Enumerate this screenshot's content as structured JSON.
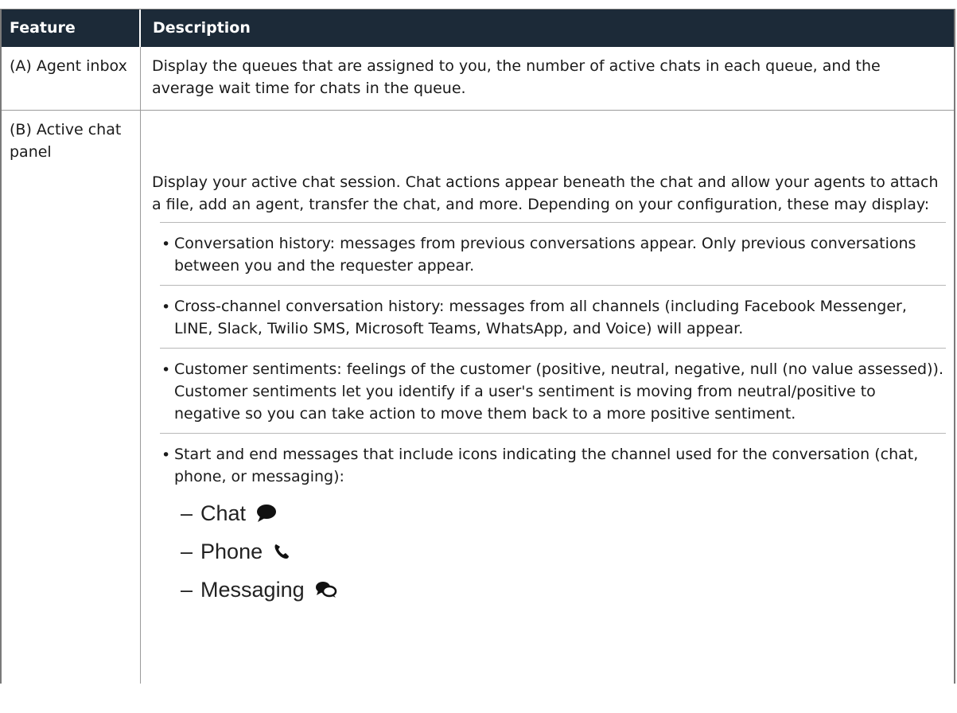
{
  "table": {
    "headers": [
      "Feature",
      "Description"
    ],
    "rows": [
      {
        "feature": "(A) Agent inbox",
        "description": "Display the queues that are assigned to you, the number of active chats in each queue, and the average wait time for chats in the queue."
      },
      {
        "feature": "(B) Active chat panel",
        "description": "Display your active chat session. Chat actions appear beneath the chat and allow your agents to attach a file, add an agent, transfer the chat, and more. Depending on your configuration, these may display:",
        "bullets": [
          "Conversation history: messages from previous conversations appear. Only previous conversations between you and the requester appear.",
          "Cross-channel conversation history: messages from all channels (including Facebook Messenger, LINE, Slack, Twilio SMS, Microsoft Teams, WhatsApp, and Voice) will appear.",
          "Customer sentiments: feelings of the customer (positive, neutral, negative, null (no value assessed)). Customer sentiments let you identify if a user's sentiment is moving from neutral/positive to negative so you can take action to move them back to a more positive sentiment.",
          "Start and end messages that include icons indicating the channel used for the conversation (chat, phone, or messaging):"
        ],
        "sub_items": [
          {
            "dash": "–",
            "label": "Chat",
            "icon": "chat-bubble-icon"
          },
          {
            "dash": "–",
            "label": "Phone",
            "icon": "phone-icon"
          },
          {
            "dash": "–",
            "label": "Messaging",
            "icon": "messaging-icon"
          }
        ]
      }
    ]
  },
  "colors": {
    "header_bg": "#1c2a38",
    "header_text": "#ffffff",
    "border": "#9a9a9a",
    "icon": "#111111"
  }
}
